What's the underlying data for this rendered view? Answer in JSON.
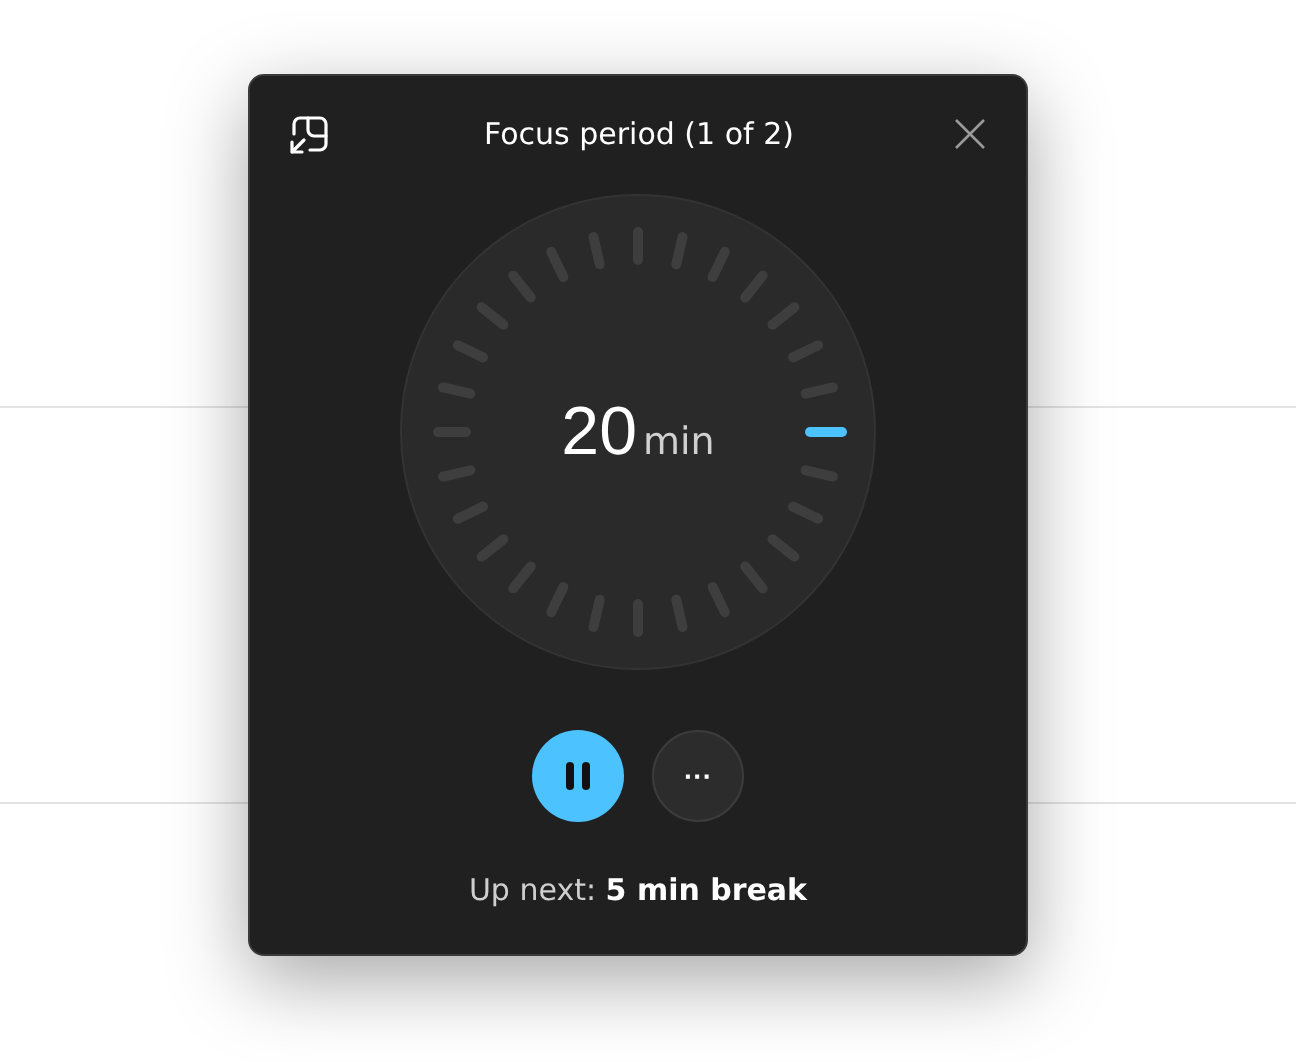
{
  "window": {
    "title": "Focus period (1 of 2)"
  },
  "timer": {
    "value": "20",
    "unit": "min"
  },
  "controls": [
    {
      "kind": "pause"
    },
    {
      "kind": "more",
      "label": "···"
    }
  ],
  "up_next": "Up next: **5 min break**"
}
